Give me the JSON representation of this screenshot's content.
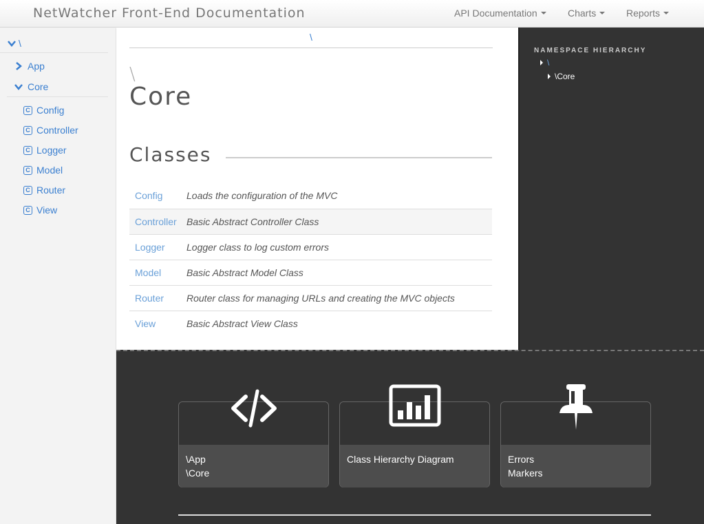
{
  "app": {
    "brand": "NetWatcher Front-End Documentation"
  },
  "nav": {
    "items": [
      {
        "label": "API Documentation"
      },
      {
        "label": "Charts"
      },
      {
        "label": "Reports"
      }
    ]
  },
  "sidebar": {
    "root": "\\",
    "namespaces": [
      {
        "label": "App"
      },
      {
        "label": "Core"
      }
    ],
    "classes": [
      "Config",
      "Controller",
      "Logger",
      "Model",
      "Router",
      "View"
    ]
  },
  "main": {
    "breadcrumb": "\\",
    "namespace_prefix": "\\",
    "namespace_title": "Core",
    "section_title": "Classes",
    "classes": [
      {
        "name": "Config",
        "description": "Loads the configuration of the MVC"
      },
      {
        "name": "Controller",
        "description": "Basic Abstract Controller Class"
      },
      {
        "name": "Logger",
        "description": "Logger class to log custom errors"
      },
      {
        "name": "Model",
        "description": "Basic Abstract Model Class"
      },
      {
        "name": "Router",
        "description": "Router class for managing URLs and creating the MVC objects"
      },
      {
        "name": "View",
        "description": "Basic Abstract View Class"
      }
    ]
  },
  "hierarchy": {
    "title": "NAMESPACE HIERARCHY",
    "items": [
      "\\",
      "\\Core"
    ]
  },
  "footer_cards": [
    {
      "icon": "code-icon",
      "line1": "\\App",
      "line2": "\\Core"
    },
    {
      "icon": "bar-chart-icon",
      "line1": "Class Hierarchy Diagram",
      "line2": ""
    },
    {
      "icon": "pin-icon",
      "line1": "Errors",
      "line2": "Markers"
    }
  ],
  "colors": {
    "link": "#3a7fd0",
    "dark_panel": "#333333",
    "card_bottom": "#4d4d4d"
  }
}
